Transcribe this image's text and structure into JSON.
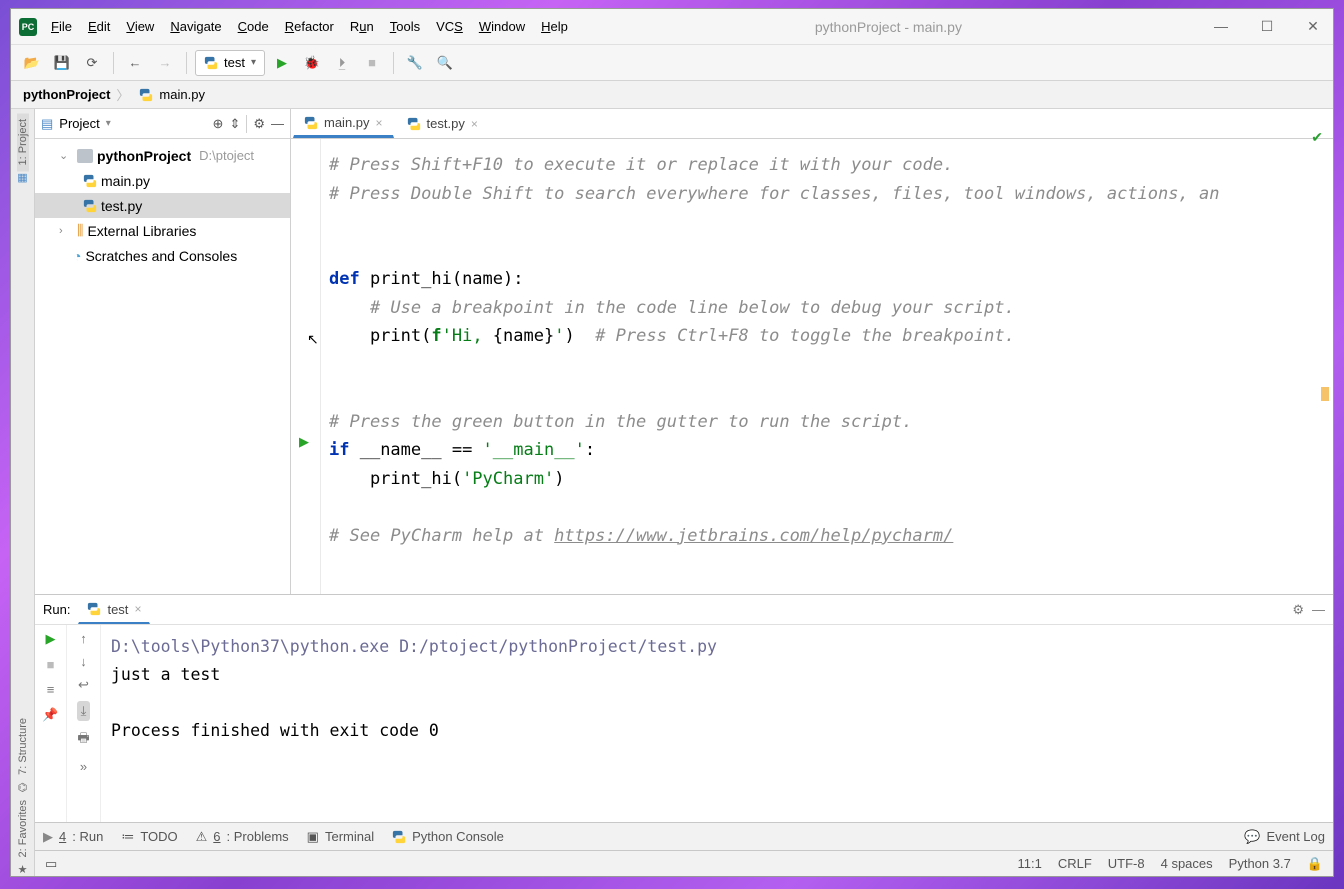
{
  "title": "pythonProject - main.py",
  "menu": [
    "File",
    "Edit",
    "View",
    "Navigate",
    "Code",
    "Refactor",
    "Run",
    "Tools",
    "VCS",
    "Window",
    "Help"
  ],
  "toolbar": {
    "run_config_label": "test"
  },
  "breadcrumb": {
    "root": "pythonProject",
    "file": "main.py"
  },
  "project_panel": {
    "title": "Project",
    "tree": {
      "root": "pythonProject",
      "root_path": "D:\\ptoject",
      "files": [
        "main.py",
        "test.py"
      ],
      "ext_libs": "External Libraries",
      "scratches": "Scratches and Consoles"
    }
  },
  "tabs": [
    {
      "name": "main.py",
      "active": true
    },
    {
      "name": "test.py",
      "active": false
    }
  ],
  "code": {
    "l1": "# Press Shift+F10 to execute it or replace it with your code.",
    "l2": "# Press Double Shift to search everywhere for classes, files, tool windows, actions, an",
    "l3": "",
    "l4": "",
    "def_kw": "def",
    "def_sig": " print_hi(name):",
    "l6": "    # Use a breakpoint in the code line below to debug your script.",
    "l7_a": "    print(",
    "l7_f": "f",
    "l7_s1": "'Hi, ",
    "l7_b": "{name}",
    "l7_s2": "'",
    "l7_c": ")",
    "l7_comment": "  # Press Ctrl+F8 to toggle the breakpoint.",
    "l10": "# Press the green button in the gutter to run the script.",
    "if_kw": "if",
    "if_rest": " __name__ == ",
    "if_str": "'__main__'",
    "if_colon": ":",
    "l12_a": "    print_hi(",
    "l12_s": "'PyCharm'",
    "l12_b": ")",
    "l14a": "# See PyCharm help at ",
    "l14b": "https://www.jetbrains.com/help/pycharm/"
  },
  "run_panel": {
    "label": "Run:",
    "tab": "test",
    "cmd": "D:\\tools\\Python37\\python.exe D:/ptoject/pythonProject/test.py",
    "out1": "just a test",
    "out2": "Process finished with exit code 0"
  },
  "bottom_tabs": {
    "run": "4: Run",
    "todo": "TODO",
    "problems": "6: Problems",
    "terminal": "Terminal",
    "pyconsole": "Python Console",
    "eventlog": "Event Log"
  },
  "left_tabs": {
    "project": "1: Project",
    "structure": "7: Structure",
    "favorites": "2: Favorites"
  },
  "status": {
    "pos": "11:1",
    "line_sep": "CRLF",
    "encoding": "UTF-8",
    "indent": "4 spaces",
    "interpreter": "Python 3.7"
  }
}
